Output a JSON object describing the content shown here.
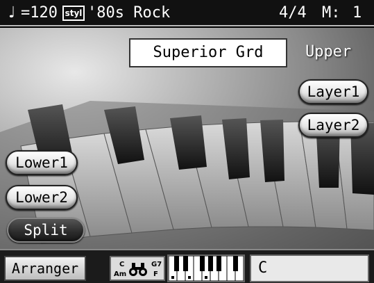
{
  "status_bar": {
    "tempo_symbol": "♩",
    "tempo": "=120",
    "style_icon": "styl",
    "style_name": "'80s Rock",
    "time_signature": "4/4",
    "measure_label": "M:",
    "measure": "1"
  },
  "tone": {
    "name": "Superior Grd",
    "part": "Upper"
  },
  "buttons": {
    "layer1": "Layer1",
    "layer2": "Layer2",
    "lower1": "Lower1",
    "lower2": "Lower2",
    "split": "Split"
  },
  "bottom_bar": {
    "arranger_label": "Arranger",
    "chord_icon_top_left": "C",
    "chord_icon_bottom_left": "Am",
    "chord_icon_top_right": "G7",
    "chord_icon_bottom_right": "F",
    "chord_value": "C"
  },
  "icons": {
    "tempo": "quarter-note-icon",
    "style": "style-icon",
    "chord": "binoculars-chord-icon",
    "keyboard": "mini-keyboard-icon"
  }
}
